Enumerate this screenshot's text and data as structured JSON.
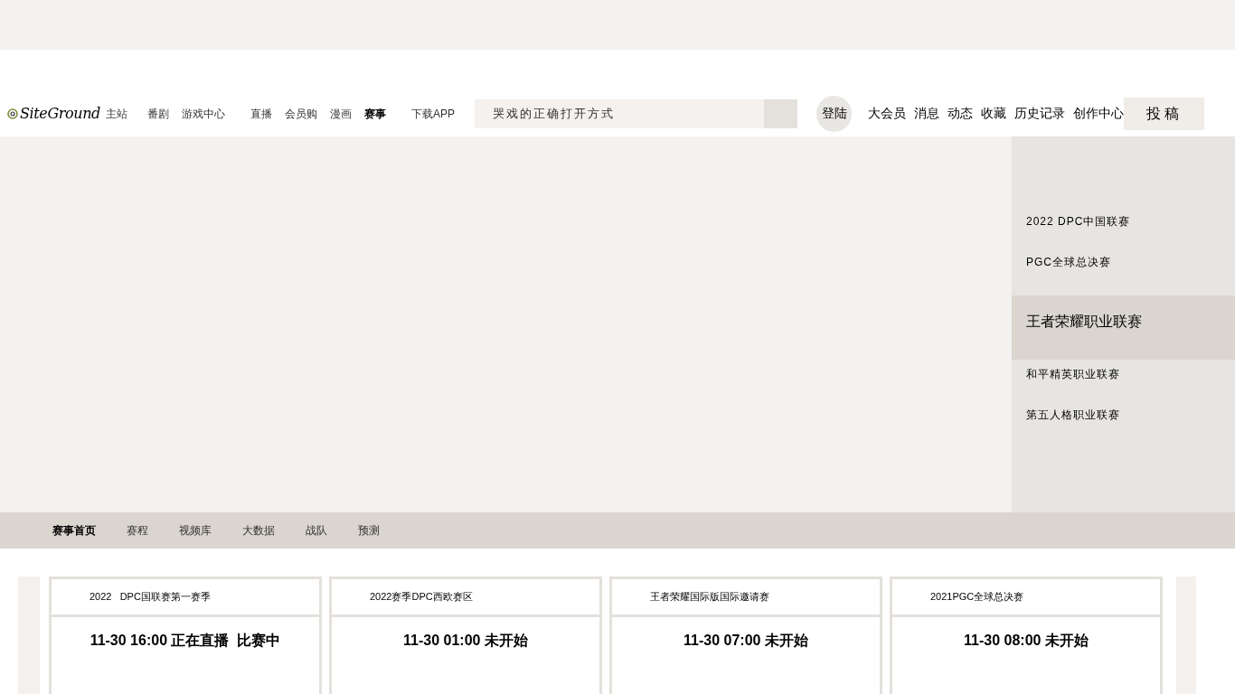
{
  "header": {
    "logo": "SiteGround",
    "nav": [
      {
        "label": "主站",
        "selected": false
      },
      {
        "label": "番剧",
        "selected": false
      },
      {
        "label": "游戏中心",
        "selected": false
      },
      {
        "label": "直播",
        "selected": false
      },
      {
        "label": "会员购",
        "selected": false
      },
      {
        "label": "漫画",
        "selected": false
      },
      {
        "label": "赛事",
        "selected": true
      },
      {
        "label": "下载APP",
        "selected": false
      }
    ],
    "search": {
      "placeholder": "哭戏的正确打开方式"
    },
    "login": "登陆",
    "links": [
      "大会员",
      "消息",
      "动态",
      "收藏",
      "历史记录",
      "创作中心"
    ],
    "upload": "投稿"
  },
  "sidebar": {
    "items": [
      {
        "label": "2022 DPC中国联赛",
        "selected": false
      },
      {
        "label": "PGC全球总决赛",
        "selected": false
      },
      {
        "label": "王者荣耀职业联赛",
        "selected": true
      },
      {
        "label": "和平精英职业联赛",
        "selected": false
      },
      {
        "label": "第五人格职业联赛",
        "selected": false
      }
    ]
  },
  "subnav": [
    {
      "label": "赛事首页",
      "selected": true
    },
    {
      "label": "赛程",
      "selected": false
    },
    {
      "label": "视频库",
      "selected": false
    },
    {
      "label": "大数据",
      "selected": false
    },
    {
      "label": "战队",
      "selected": false
    },
    {
      "label": "预测",
      "selected": false
    }
  ],
  "matches": [
    {
      "title": "2022   DPC国联赛第一赛季",
      "status": "11-30 16:00 正在直播  比赛中"
    },
    {
      "title": "2022赛季DPC西欧赛区",
      "status": "11-30 01:00 未开始"
    },
    {
      "title": "王者荣耀国际版国际邀请赛",
      "status": "11-30 07:00 未开始"
    },
    {
      "title": "2021PGC全球总决赛",
      "status": "11-30 08:00 未开始"
    }
  ]
}
